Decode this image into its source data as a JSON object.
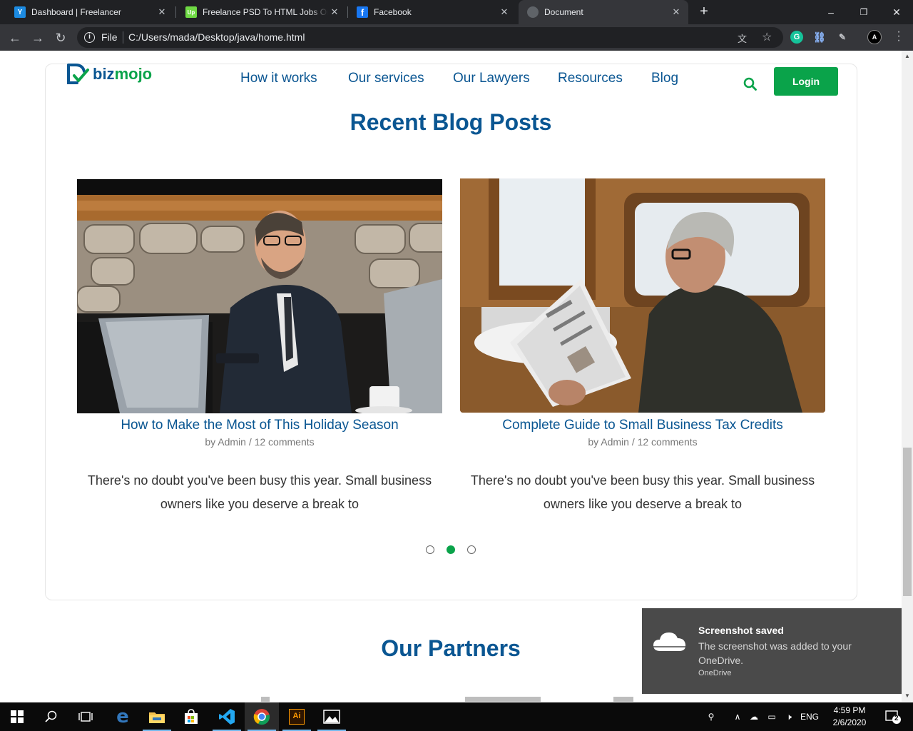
{
  "browser": {
    "tabs": [
      {
        "title": "Dashboard | Freelancer",
        "favicon": "freelancer-icon",
        "color": "#1c8be2",
        "glyph": "Y"
      },
      {
        "title": "Freelance PSD To HTML Jobs Online",
        "favicon": "upwork-icon",
        "color": "#6fda44",
        "glyph": "Up"
      },
      {
        "title": "Facebook",
        "favicon": "facebook-icon",
        "color": "#1877f2",
        "glyph": "f"
      },
      {
        "title": "Document",
        "favicon": "globe-icon",
        "color": "#9aa0a6",
        "glyph": ""
      }
    ],
    "active_tab": 3,
    "new_tab": "+",
    "address": {
      "scheme_label": "File",
      "url": "C:/Users/mada/Desktop/java/home.html"
    },
    "window_controls": {
      "minimize": "–",
      "restore": "❐",
      "close": "✕"
    }
  },
  "site": {
    "logo": {
      "part1": "biz",
      "part2": "mojo"
    },
    "nav": [
      {
        "label": "How it works"
      },
      {
        "label": "Our services"
      },
      {
        "label": "Our Lawyers"
      },
      {
        "label": "Resources"
      },
      {
        "label": "Blog"
      }
    ],
    "login_label": "Login",
    "colors": {
      "primary": "#0a5692",
      "accent": "#0aa34a"
    }
  },
  "blog": {
    "title": "Recent Blog Posts",
    "posts": [
      {
        "title": "How to Make the Most of This Holiday Season",
        "meta": "by Admin / 12 comments",
        "excerpt": "There's no doubt you've been busy this year. Small business owners like you deserve a break to"
      },
      {
        "title": "Complete Guide to Small Business Tax Credits",
        "meta": "by Admin / 12 comments",
        "excerpt": "There's no doubt you've been busy this year. Small business owners like you deserve a break to"
      }
    ],
    "carousel": {
      "pages": 3,
      "active": 2
    }
  },
  "partners": {
    "title": "Our Partners"
  },
  "toast": {
    "title": "Screenshot saved",
    "body": "The screenshot was added to your OneDrive.",
    "source": "OneDrive"
  },
  "taskbar": {
    "apps": [
      "start-icon",
      "search-icon",
      "task-view-icon",
      "edge-icon",
      "file-explorer-icon",
      "store-icon",
      "vscode-icon",
      "chrome-icon",
      "illustrator-icon",
      "photos-icon"
    ],
    "language": "ENG",
    "time": "4:59 PM",
    "date": "2/6/2020",
    "notifications": "2"
  }
}
